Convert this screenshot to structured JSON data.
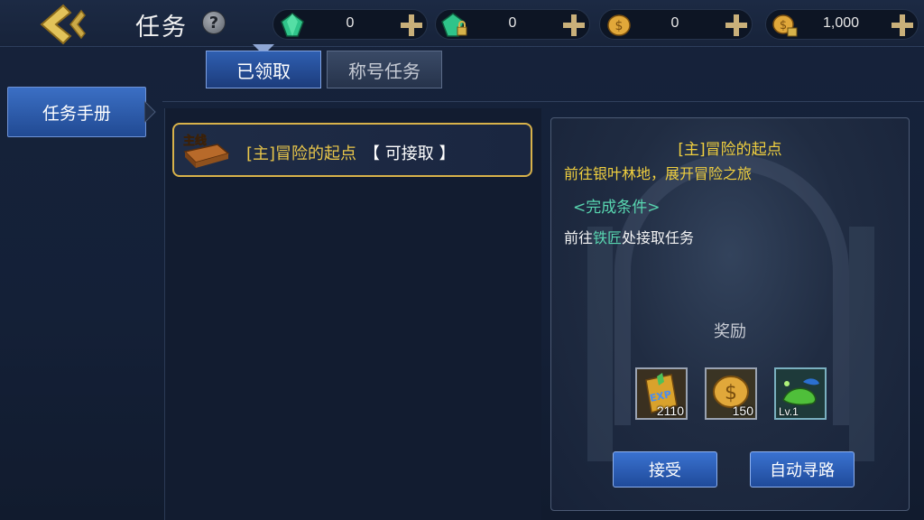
{
  "header": {
    "title": "任务",
    "help_label": "?",
    "currencies": [
      {
        "icon": "green-gem-icon",
        "value": "0"
      },
      {
        "icon": "locked-green-gem-icon",
        "value": "0"
      },
      {
        "icon": "gold-coin-icon",
        "value": "0"
      },
      {
        "icon": "locked-gold-coin-icon",
        "value": "1,000"
      }
    ]
  },
  "tabs": [
    {
      "label": "已领取",
      "active": true
    },
    {
      "label": "称号任务",
      "active": false
    }
  ],
  "sidebar": {
    "items": [
      {
        "label": "任务手册"
      }
    ]
  },
  "quest_list": [
    {
      "badge": "主线",
      "name": "[主]冒险的起点",
      "status": "【 可接取 】"
    }
  ],
  "detail": {
    "title": "[主]冒险的起点",
    "description": "前往银叶林地，展开冒险之旅",
    "condition_heading": "<完成条件>",
    "task_prefix": "前往",
    "task_highlight": "铁匠",
    "task_suffix": "处接取任务",
    "reward_label": "奖励",
    "rewards": [
      {
        "icon": "exp-book-icon",
        "count": "2110"
      },
      {
        "icon": "gold-coin-icon",
        "count": "150"
      },
      {
        "icon": "green-lamp-icon",
        "level": "Lv.1"
      }
    ],
    "accept_label": "接受",
    "auto_path_label": "自动寻路"
  },
  "colors": {
    "accent_gold": "#f0cf3f",
    "accent_teal": "#58d6b0",
    "button_blue": "#2f5fb1"
  }
}
